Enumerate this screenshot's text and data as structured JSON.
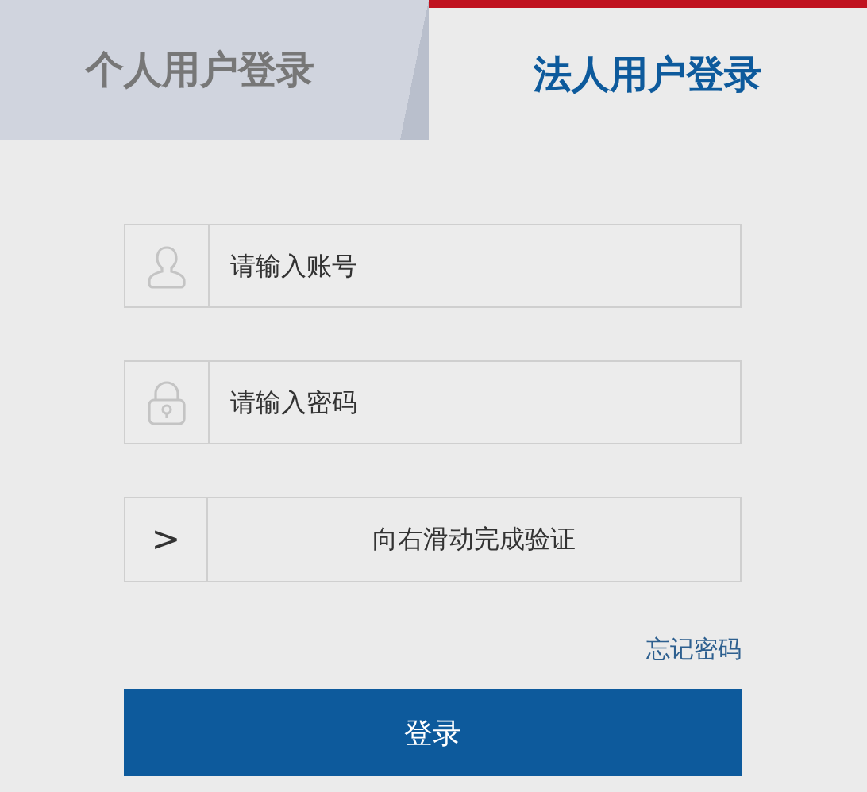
{
  "tabs": [
    {
      "label": "个人用户登录",
      "selected": false
    },
    {
      "label": "法人用户登录",
      "selected": true
    }
  ],
  "account_field": {
    "placeholder": "请输入账号"
  },
  "password_field": {
    "placeholder": "请输入密码"
  },
  "slider": {
    "label": "向右滑动完成验证",
    "handle": ">"
  },
  "forgot_link": "忘记密码",
  "login_button": "登录"
}
